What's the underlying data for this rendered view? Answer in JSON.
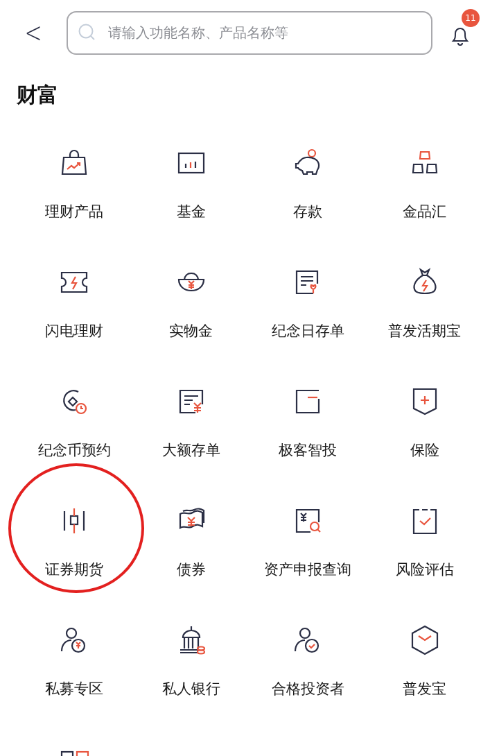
{
  "header": {
    "back": "<",
    "search": {
      "placeholder": "请输入功能名称、产品名称等"
    },
    "notifications": {
      "count": "11"
    }
  },
  "section": {
    "title": "财富",
    "items": [
      {
        "label": "理财产品",
        "highlighted": false
      },
      {
        "label": "基金",
        "highlighted": false
      },
      {
        "label": "存款",
        "highlighted": false
      },
      {
        "label": "金品汇",
        "highlighted": false
      },
      {
        "label": "闪电理财",
        "highlighted": false
      },
      {
        "label": "实物金",
        "highlighted": false
      },
      {
        "label": "纪念日存单",
        "highlighted": false
      },
      {
        "label": "普发活期宝",
        "highlighted": false
      },
      {
        "label": "纪念币预约",
        "highlighted": false
      },
      {
        "label": "大额存单",
        "highlighted": false
      },
      {
        "label": "极客智投",
        "highlighted": false
      },
      {
        "label": "保险",
        "highlighted": false
      },
      {
        "label": "证券期货",
        "highlighted": true
      },
      {
        "label": "债券",
        "highlighted": false
      },
      {
        "label": "资产申报查询",
        "highlighted": false
      },
      {
        "label": "风险评估",
        "highlighted": false
      },
      {
        "label": "私募专区",
        "highlighted": false
      },
      {
        "label": "私人银行",
        "highlighted": false
      },
      {
        "label": "合格投资者",
        "highlighted": false
      },
      {
        "label": "普发宝",
        "highlighted": false
      }
    ]
  }
}
